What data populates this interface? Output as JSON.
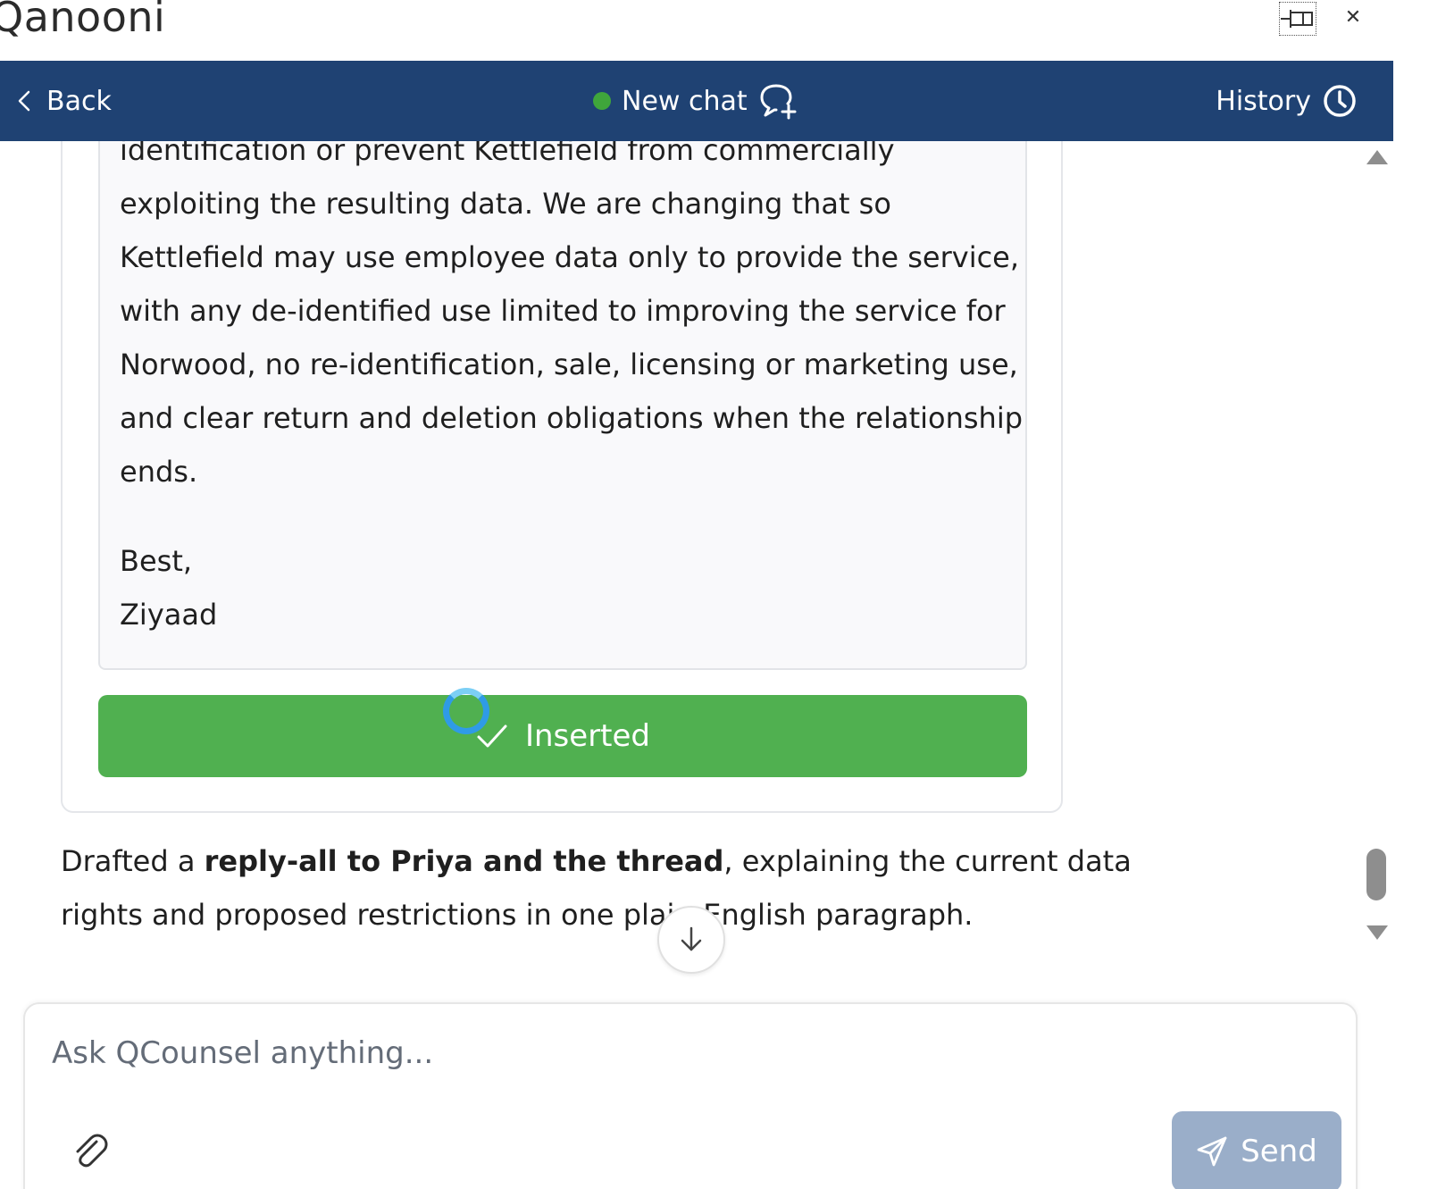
{
  "app": {
    "title": "Qanooni"
  },
  "nav": {
    "back_label": "Back",
    "new_chat_label": "New chat",
    "history_label": "History",
    "status_color": "#3fa63b"
  },
  "email": {
    "lines": [
      "identification or prevent Kettlefield from commercially",
      "exploiting the resulting data. We are changing that so",
      "Kettlefield may use employee data only to provide the service,",
      "with any de-identified use limited to improving the service for",
      "Norwood, no re-identification, sale, licensing or marketing use,",
      "and clear return and deletion obligations when the relationship",
      "ends."
    ],
    "signoff": "Best,",
    "signature": "Ziyaad"
  },
  "inserted_button": {
    "label": "Inserted",
    "color": "#50b050"
  },
  "summary": {
    "prefix": "Drafted a ",
    "bold": "reply-all to Priya and the thread",
    "suffix": ", explaining the current data rights and proposed restrictions in one plain-English paragraph."
  },
  "composer": {
    "placeholder": "Ask QCounsel anything...",
    "send_label": "Send"
  },
  "colors": {
    "navbar": "#1f4273",
    "send": "#9aaec9"
  },
  "icons": [
    "pin-icon",
    "close-icon",
    "chevron-left-icon",
    "new-chat-icon",
    "history-clock-icon",
    "check-icon",
    "spinner-icon",
    "arrow-down-icon",
    "paperclip-icon",
    "send-icon"
  ]
}
